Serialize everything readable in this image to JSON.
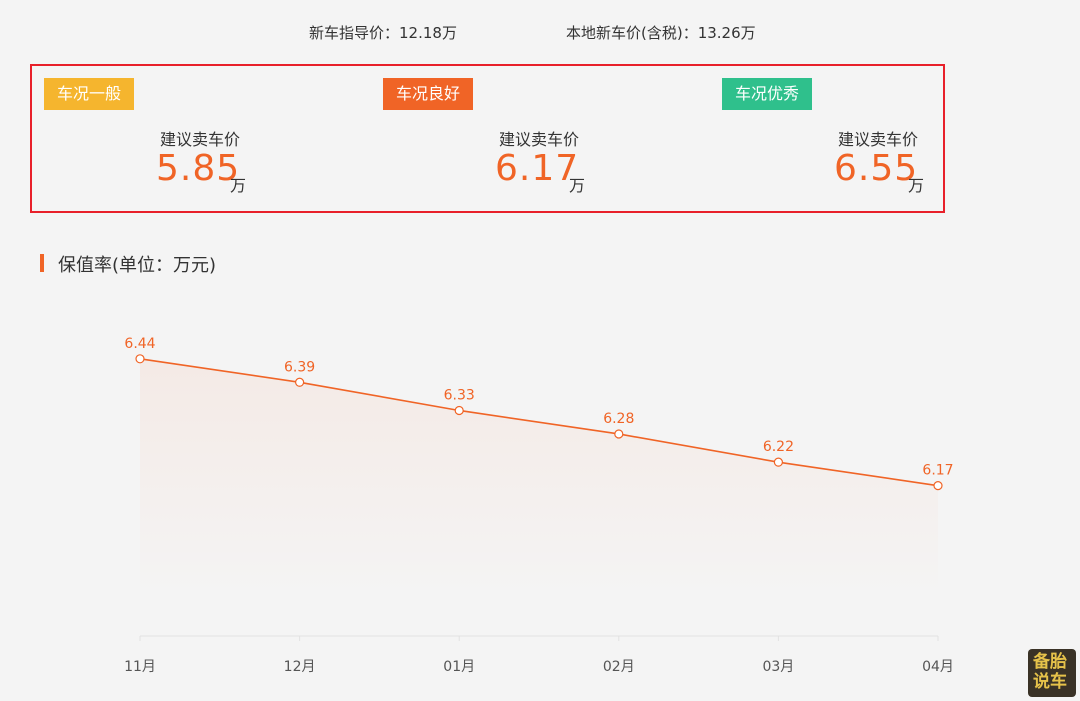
{
  "header": {
    "guide_price": "新车指导价：12.18万",
    "local_price": "本地新车价(含税)：13.26万"
  },
  "cards": [
    {
      "badge": "车况一般",
      "badge_color": "#f5b52e",
      "label": "建议卖车价",
      "price": "5.85",
      "unit": "万"
    },
    {
      "badge": "车况良好",
      "badge_color": "#f06426",
      "label": "建议卖车价",
      "price": "6.17",
      "unit": "万"
    },
    {
      "badge": "车况优秀",
      "badge_color": "#2fc08c",
      "label": "建议卖车价",
      "price": "6.55",
      "unit": "万"
    }
  ],
  "section_title": "保值率(单位：万元)",
  "chart_data": {
    "type": "line",
    "categories": [
      "11月",
      "12月",
      "01月",
      "02月",
      "03月",
      "04月"
    ],
    "values": [
      6.44,
      6.39,
      6.33,
      6.28,
      6.22,
      6.17
    ],
    "data_labels": [
      "6.44",
      "6.39",
      "6.33",
      "6.28",
      "6.22",
      "6.17"
    ],
    "ylim": [
      5.85,
      6.48
    ],
    "line_color": "#f06426",
    "grid": false,
    "area_fill": true
  },
  "watermark": "备胎说车"
}
